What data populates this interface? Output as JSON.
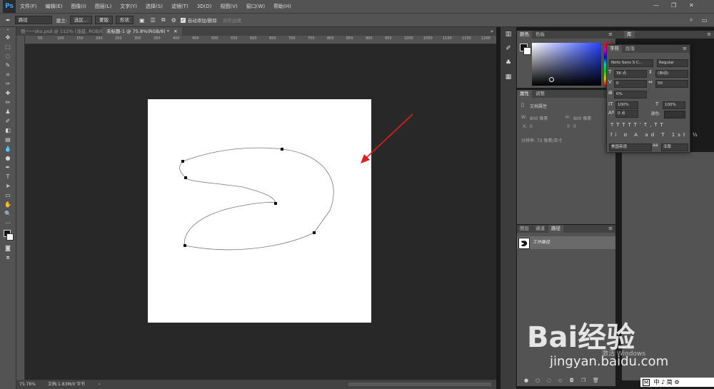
{
  "app": {
    "logo": "Ps"
  },
  "menu": [
    "文件(F)",
    "编辑(E)",
    "图像(I)",
    "图层(L)",
    "文字(Y)",
    "选择(S)",
    "滤镜(T)",
    "3D(D)",
    "视图(V)",
    "窗口(W)",
    "帮助(H)"
  ],
  "options": {
    "mode": "路径",
    "make_label": "建立:",
    "selection_btn": "选区...",
    "mask_btn": "蒙版",
    "shape_btn": "形状",
    "auto_add": "自动添加/删除",
    "align_edges": "对齐边缘"
  },
  "tabs": [
    {
      "label": "倒一一sku.psd @ 112% (浅蓝, RGB/8)",
      "active": false
    },
    {
      "label": "未标题-1 @ 75.8%(RGB/8) *",
      "active": true
    }
  ],
  "ruler": [
    "50",
    "100",
    "150",
    "200",
    "250",
    "300",
    "350",
    "400",
    "450",
    "500",
    "550",
    "600",
    "650",
    "700",
    "750",
    "800",
    "850",
    "900",
    "950",
    "1000",
    "1050",
    "1100",
    "1150",
    "1200"
  ],
  "status": {
    "zoom": "75.76%",
    "doc": "文档:1.83M/0 字节"
  },
  "color_panel": {
    "tabs": [
      "颜色",
      "色板"
    ],
    "accent": "#2442ff"
  },
  "library": {
    "tab": "库"
  },
  "properties": {
    "tabs": [
      "属性",
      "调整"
    ],
    "title": "文档属性",
    "w_label": "W:",
    "w_value": "800 像素",
    "h_label": "H:",
    "h_value": "800 像素",
    "x_label": "X:",
    "x_value": "0",
    "y_label": "Y:",
    "y_value": "0",
    "resolution": "分辨率: 72 像素/英寸"
  },
  "paths": {
    "tabs": [
      "图层",
      "通道",
      "路径"
    ],
    "item": "工作路径"
  },
  "character": {
    "tabs": [
      "字符",
      "段落"
    ],
    "font": "Noto Sans S C...",
    "style": "Regular",
    "size": "36 点",
    "leading": "(自动)",
    "kerning": "0",
    "tracking": "50",
    "scale_pct": "0%",
    "vscale": "100%",
    "hscale": "100%",
    "baseline": "0 点",
    "color_label": "颜色:",
    "lang": "美国英语",
    "aa": "浑厚"
  },
  "ime": "中 ♪ 简 ⚙",
  "watermark": {
    "brand": "Bai经验",
    "url": "jingyan.baidu.com",
    "activate": "激活 Windows"
  }
}
